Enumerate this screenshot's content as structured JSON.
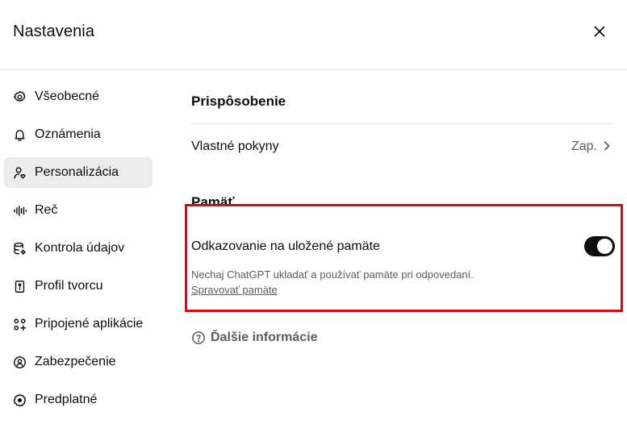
{
  "dialog": {
    "title": "Nastavenia"
  },
  "sidebar": {
    "items": [
      {
        "label": "Všeobecné",
        "icon": "gear-icon"
      },
      {
        "label": "Oznámenia",
        "icon": "bell-icon"
      },
      {
        "label": "Personalizácia",
        "icon": "person-heart-icon",
        "active": true
      },
      {
        "label": "Reč",
        "icon": "waveform-icon"
      },
      {
        "label": "Kontrola údajov",
        "icon": "database-icon"
      },
      {
        "label": "Profil tvorcu",
        "icon": "id-card-icon"
      },
      {
        "label": "Pripojené aplikácie",
        "icon": "apps-icon"
      },
      {
        "label": "Zabezpečenie",
        "icon": "shield-icon"
      },
      {
        "label": "Predplatné",
        "icon": "badge-icon"
      }
    ]
  },
  "main": {
    "customization": {
      "title": "Prispôsobenie",
      "instructions_label": "Vlastné pokyny",
      "instructions_value": "Zap."
    },
    "memory": {
      "title": "Pamäť",
      "saved_memories_label": "Odkazovanie na uložené pamäte",
      "saved_memories_enabled": true,
      "description": "Nechaj ChatGPT ukladať a používať pamäte pri odpovedaní.",
      "manage_link": "Spravovať pamäte",
      "learn_more": "Ďalšie informácie"
    }
  },
  "colors": {
    "highlight": "#e8000e",
    "active_nav": "#ececec",
    "toggle_on": "#0d0d0d",
    "muted_text": "#5d5d5d"
  }
}
